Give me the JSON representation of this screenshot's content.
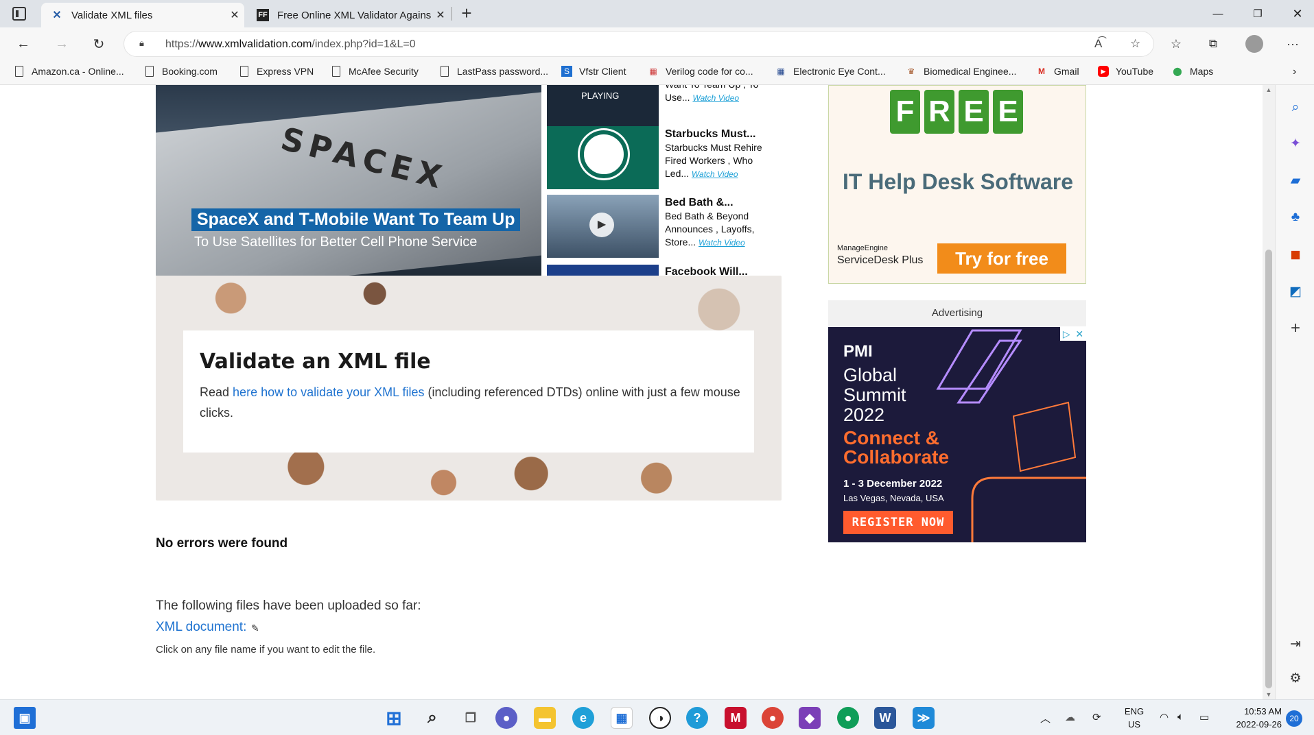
{
  "browser": {
    "tabs": [
      {
        "title": "Validate XML files",
        "active": true
      },
      {
        "title": "Free Online XML Validator Agains",
        "active": false
      }
    ],
    "url_prefix": "https://",
    "url_host": "www.xmlvalidation.com",
    "url_path": "/index.php?id=1&L=0",
    "bookmarks": [
      {
        "label": "Amazon.ca - Online..."
      },
      {
        "label": "Booking.com"
      },
      {
        "label": "Express VPN"
      },
      {
        "label": "McAfee Security"
      },
      {
        "label": "LastPass password..."
      },
      {
        "label": "Vfstr Client"
      },
      {
        "label": "Verilog code for co..."
      },
      {
        "label": "Electronic Eye Cont..."
      },
      {
        "label": "Biomedical Enginee..."
      },
      {
        "label": "Gmail"
      },
      {
        "label": "YouTube"
      },
      {
        "label": "Maps"
      }
    ]
  },
  "video": {
    "headline": "SpaceX and T-Mobile Want To Team Up",
    "subline": "To Use Satellites for Better Cell Phone Service",
    "logo": "SPACEX",
    "playing": "PLAYING",
    "items": [
      {
        "title": "",
        "desc": "Want To Team Up , To Use...",
        "watch": "Watch Video"
      },
      {
        "title": "Starbucks Must...",
        "desc": "Starbucks Must Rehire Fired Workers , Who Led...",
        "watch": "Watch Video"
      },
      {
        "title": "Bed Bath &...",
        "desc": "Bed Bath & Beyond Announces , Layoffs, Store...",
        "watch": "Watch Video"
      },
      {
        "title": "Facebook Will...",
        "desc": "",
        "watch": ""
      }
    ]
  },
  "main": {
    "heading": "Validate an XML file",
    "intro_before": "Read ",
    "intro_link": "here how to validate your XML files",
    "intro_after": " (including referenced DTDs) online with just a few mouse clicks.",
    "result": "No errors were found",
    "uploaded_text": "The following files have been uploaded so far:",
    "file_link": "XML document:",
    "edit_hint": "Click on any file name if you want to edit the file."
  },
  "ads": {
    "ad1": {
      "free_letters": [
        "F",
        "R",
        "E",
        "E"
      ],
      "headline": "IT Help Desk Software",
      "brand_small": "ManageEngine",
      "brand": "ServiceDesk Plus",
      "cta": "Try for free"
    },
    "label": "Advertising",
    "ad2": {
      "logo": "PMI",
      "event": "Global Summit 2022",
      "tagline": "Connect & Collaborate",
      "dates": "1 - 3 December 2022",
      "location": "Las Vegas, Nevada, USA",
      "cta": "REGISTER NOW"
    }
  },
  "taskbar": {
    "lang1": "ENG",
    "lang2": "US",
    "time": "10:53 AM",
    "date": "2022-09-26",
    "notifications": "20"
  },
  "colors": {
    "accent_link": "#1f73d0",
    "cta_orange": "#f28c1a"
  }
}
